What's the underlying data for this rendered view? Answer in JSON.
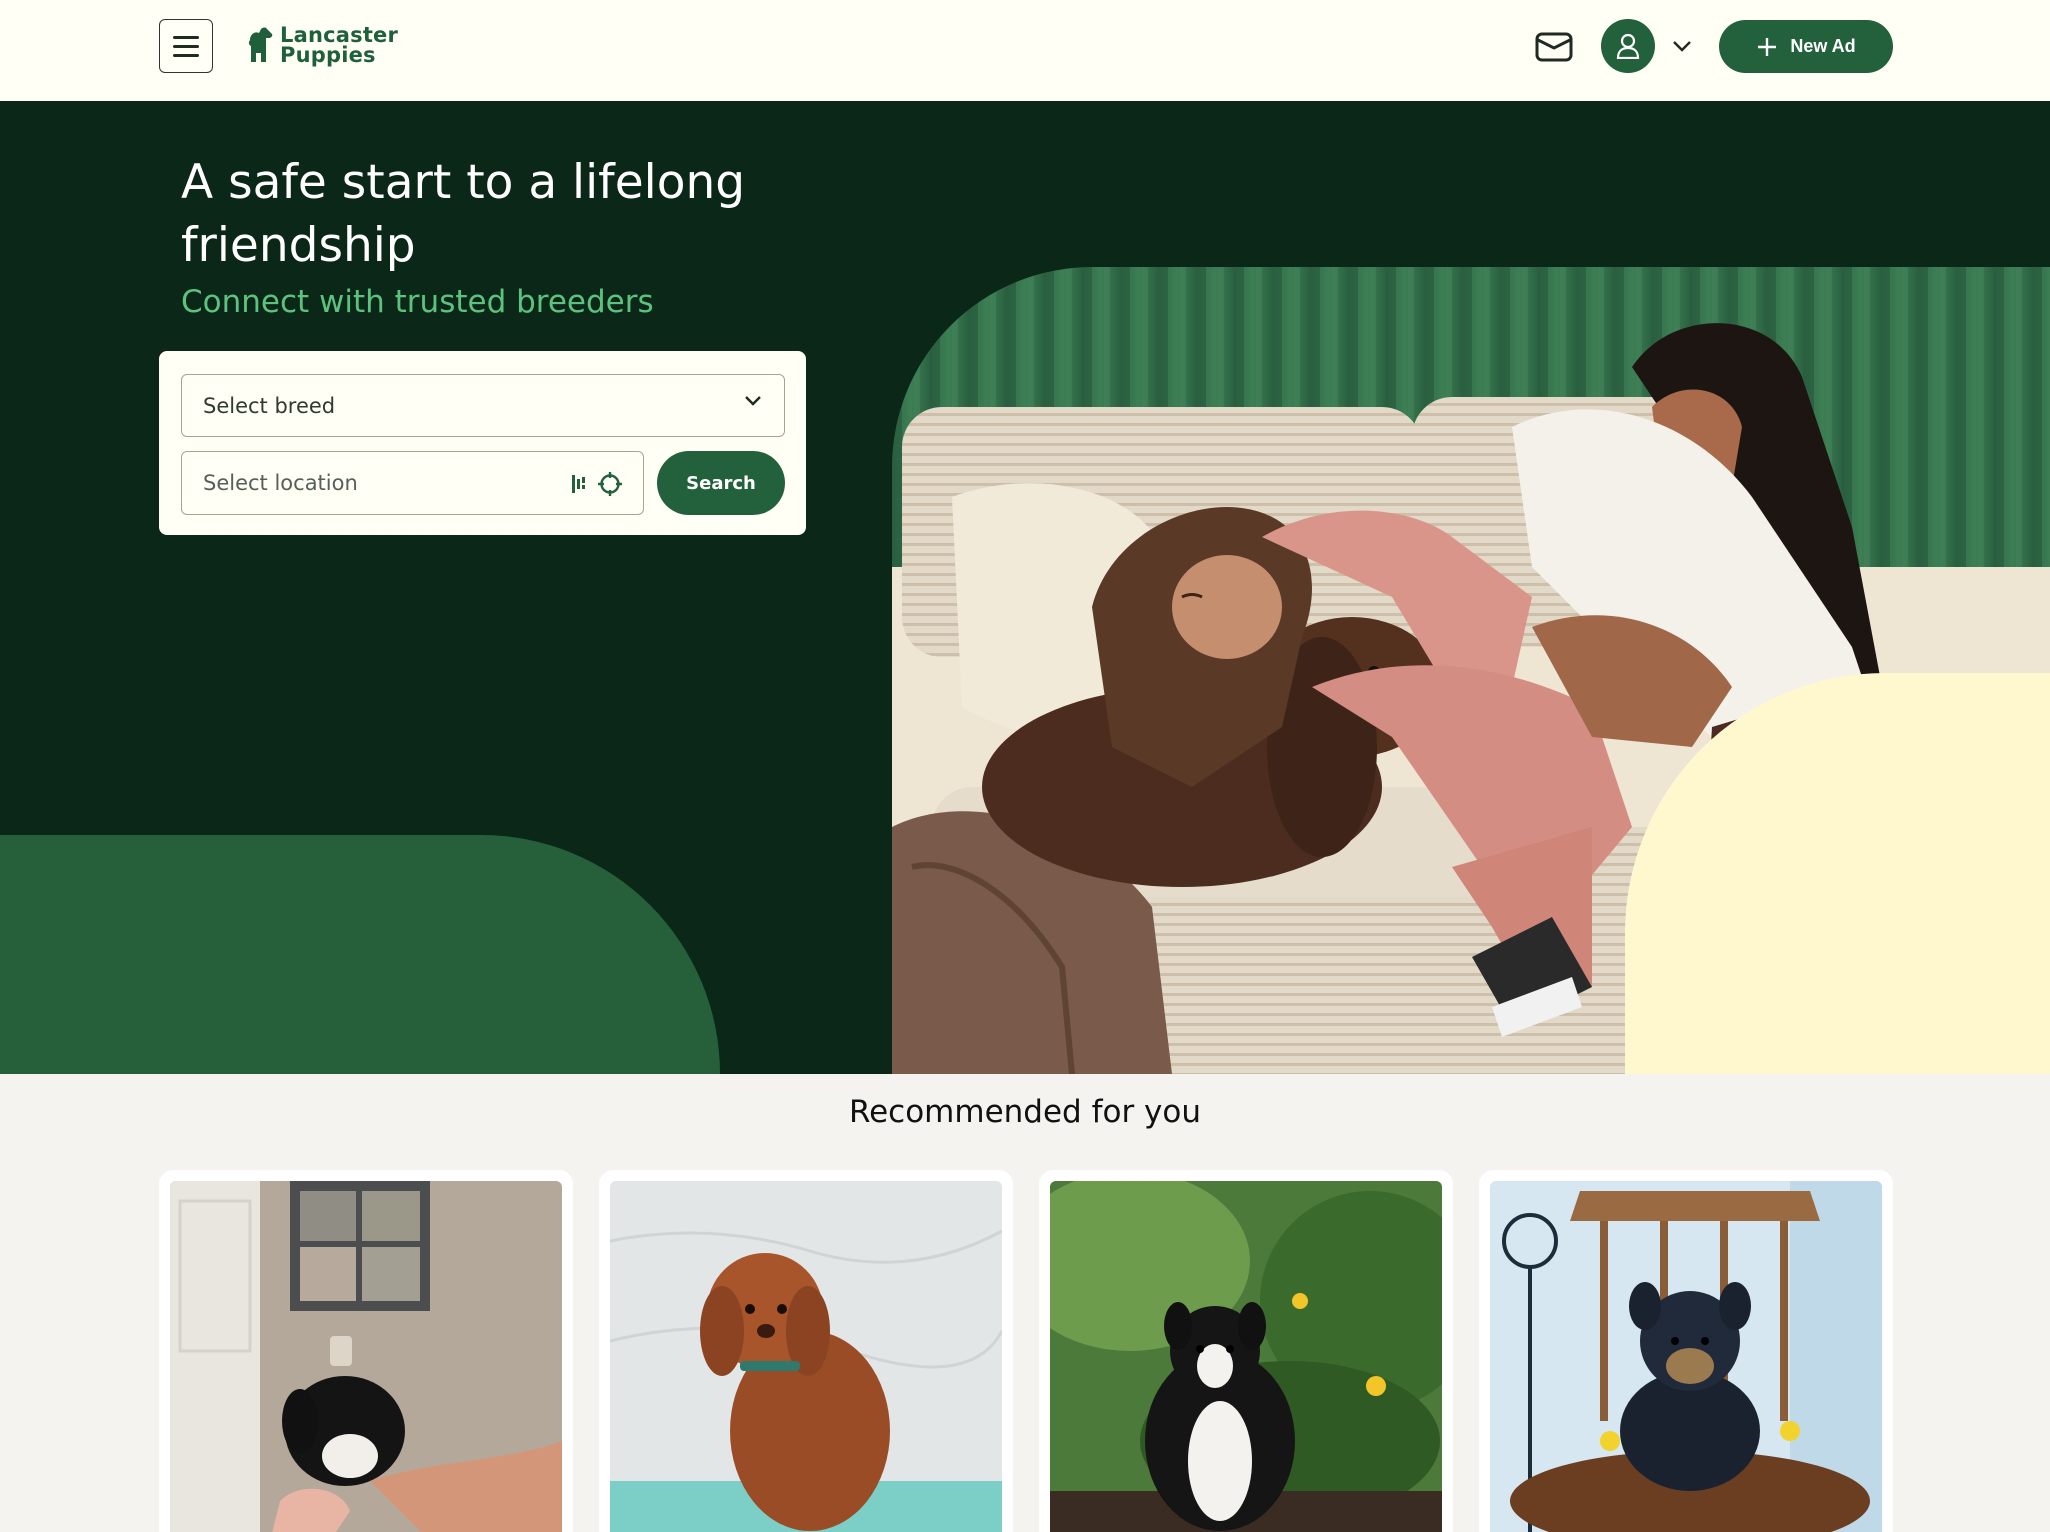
{
  "brand": {
    "line1": "Lancaster",
    "line2": "Puppies",
    "color": "#1f5f3b"
  },
  "header": {
    "new_ad_label": "New Ad",
    "icons": [
      "menu-icon",
      "mail-icon",
      "user-icon",
      "chevron-down-icon",
      "plus-icon"
    ]
  },
  "hero": {
    "title": "A safe start to a lifelong friendship",
    "subtitle": "Connect with trusted breeders",
    "breed_select": {
      "value": "Select breed"
    },
    "location": {
      "placeholder": "Select location"
    },
    "search_label": "Search",
    "colors": {
      "dark_green": "#0b2718",
      "mid_green": "#25603b",
      "accent_green": "#5cc27e",
      "cream": "#fff8cf"
    }
  },
  "recommended": {
    "title": "Recommended for you",
    "cards": [
      {
        "image": "black-white-puppy-held-in-hand"
      },
      {
        "image": "red-curly-poodle-puppy"
      },
      {
        "image": "tricolor-sheltie-puppy-in-garden"
      },
      {
        "image": "yorkie-puppy-on-wooden-chair"
      }
    ]
  }
}
